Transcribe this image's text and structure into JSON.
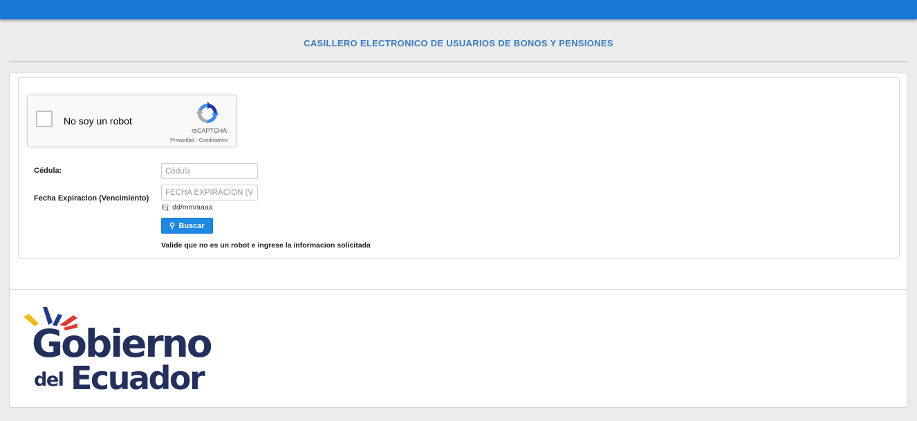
{
  "header": {
    "title": "CASILLERO ELECTRONICO DE USUARIOS DE BONOS Y PENSIONES"
  },
  "recaptcha": {
    "label": "No soy un robot",
    "brand": "reCAPTCHA",
    "privacy": "Privacidad",
    "separator": " - ",
    "terms": "Condiciones",
    "checked": false
  },
  "form": {
    "cedula_label": "Cédula:",
    "cedula_placeholder": "Cédula",
    "cedula_value": "",
    "fecha_label": "Fecha Expiracion (Vencimiento)",
    "fecha_placeholder": "FECHA EXPIRACION (VENCIMIENTO)",
    "fecha_value": "",
    "fecha_hint": "Ej: dd/mm/aaaa",
    "search_label": "Buscar",
    "message": "Valide que no es un robot e ingrese la informacion solicitada"
  },
  "footer": {
    "logo_line1": "Gobierno",
    "logo_line2_small": "del",
    "logo_line2_big": "Ecuador"
  },
  "colors": {
    "topbar": "#1976d2",
    "title": "#3a7cc4",
    "button": "#1e88e5",
    "logo_text": "#23305e",
    "logo_yellow": "#f0b81a",
    "logo_blue": "#1f3a8a",
    "logo_red": "#e03a2f"
  }
}
